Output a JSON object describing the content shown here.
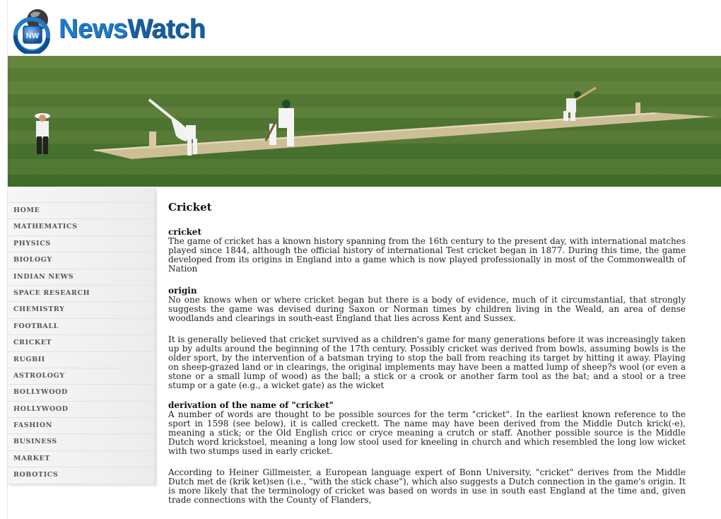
{
  "brand": {
    "name_part1": "News",
    "name_part2": "Watch",
    "badge": "NW",
    "color": "#1f79c8"
  },
  "nav": {
    "items": [
      "HOME",
      "MATHEMATICS",
      "PHYSICS",
      "BIOLOGY",
      "INDIAN NEWS",
      "SPACE RESEARCH",
      "CHEMISTRY",
      "FOOTBALL",
      "CRICKET",
      "RUGBII",
      "ASTROLOGY",
      "BOLLYWOOD",
      "HOLLYWOOD",
      "FASHION",
      "BUSINESS",
      "MARKET",
      "ROBOTICS"
    ]
  },
  "article": {
    "title": "Cricket",
    "sections": [
      {
        "heading": "cricket",
        "paragraphs": [
          "The game of cricket has a known history spanning from the 16th century to the present day, with international matches played since 1844, although the official history of international Test cricket began in 1877. During this time, the game developed from its origins in England into a game which is now played professionally in most of the Commonwealth of Nation"
        ]
      },
      {
        "heading": "origin",
        "paragraphs": [
          "No one knows when or where cricket began but there is a body of evidence, much of it circumstantial, that strongly suggests the game was devised during Saxon or Norman times by children living in the Weald, an area of dense woodlands and clearings in south-east England that lies across Kent and Sussex.",
          "It is generally believed that cricket survived as a children's game for many generations before it was increasingly taken up by adults around the beginning of the 17th century. Possibly cricket was derived from bowls, assuming bowls is the older sport, by the intervention of a batsman trying to stop the ball from reaching its target by hitting it away. Playing on sheep-grazed land or in clearings, the original implements may have been a matted lump of sheep?s wool (or even a stone or a small lump of wood) as the ball; a stick or a crook or another farm tool as the bat; and a stool or a tree stump or a gate (e.g., a wicket gate) as the wicket"
        ]
      },
      {
        "heading": "derivation of the name of \"cricket\"",
        "paragraphs": [
          "A number of words are thought to be possible sources for the term \"cricket\". In the earliest known reference to the sport in 1598 (see below), it is called creckett. The name may have been derived from the Middle Dutch krick(-e), meaning a stick; or the Old English cricc or cryce meaning a crutch or staff. Another possible source is the Middle Dutch word krickstoel, meaning a long low stool used for kneeling in church and which resembled the long low wicket with two stumps used in early cricket.",
          "According to Heiner Gillmeister, a European language expert of Bonn University, \"cricket\" derives from the Middle Dutch met de (krik ket)sen (i.e., \"with the stick chase\"), which also suggests a Dutch connection in the game's origin. It is more likely that the terminology of cricket was based on words in use in south east England at the time and, given trade connections with the County of Flanders,"
        ]
      }
    ]
  }
}
